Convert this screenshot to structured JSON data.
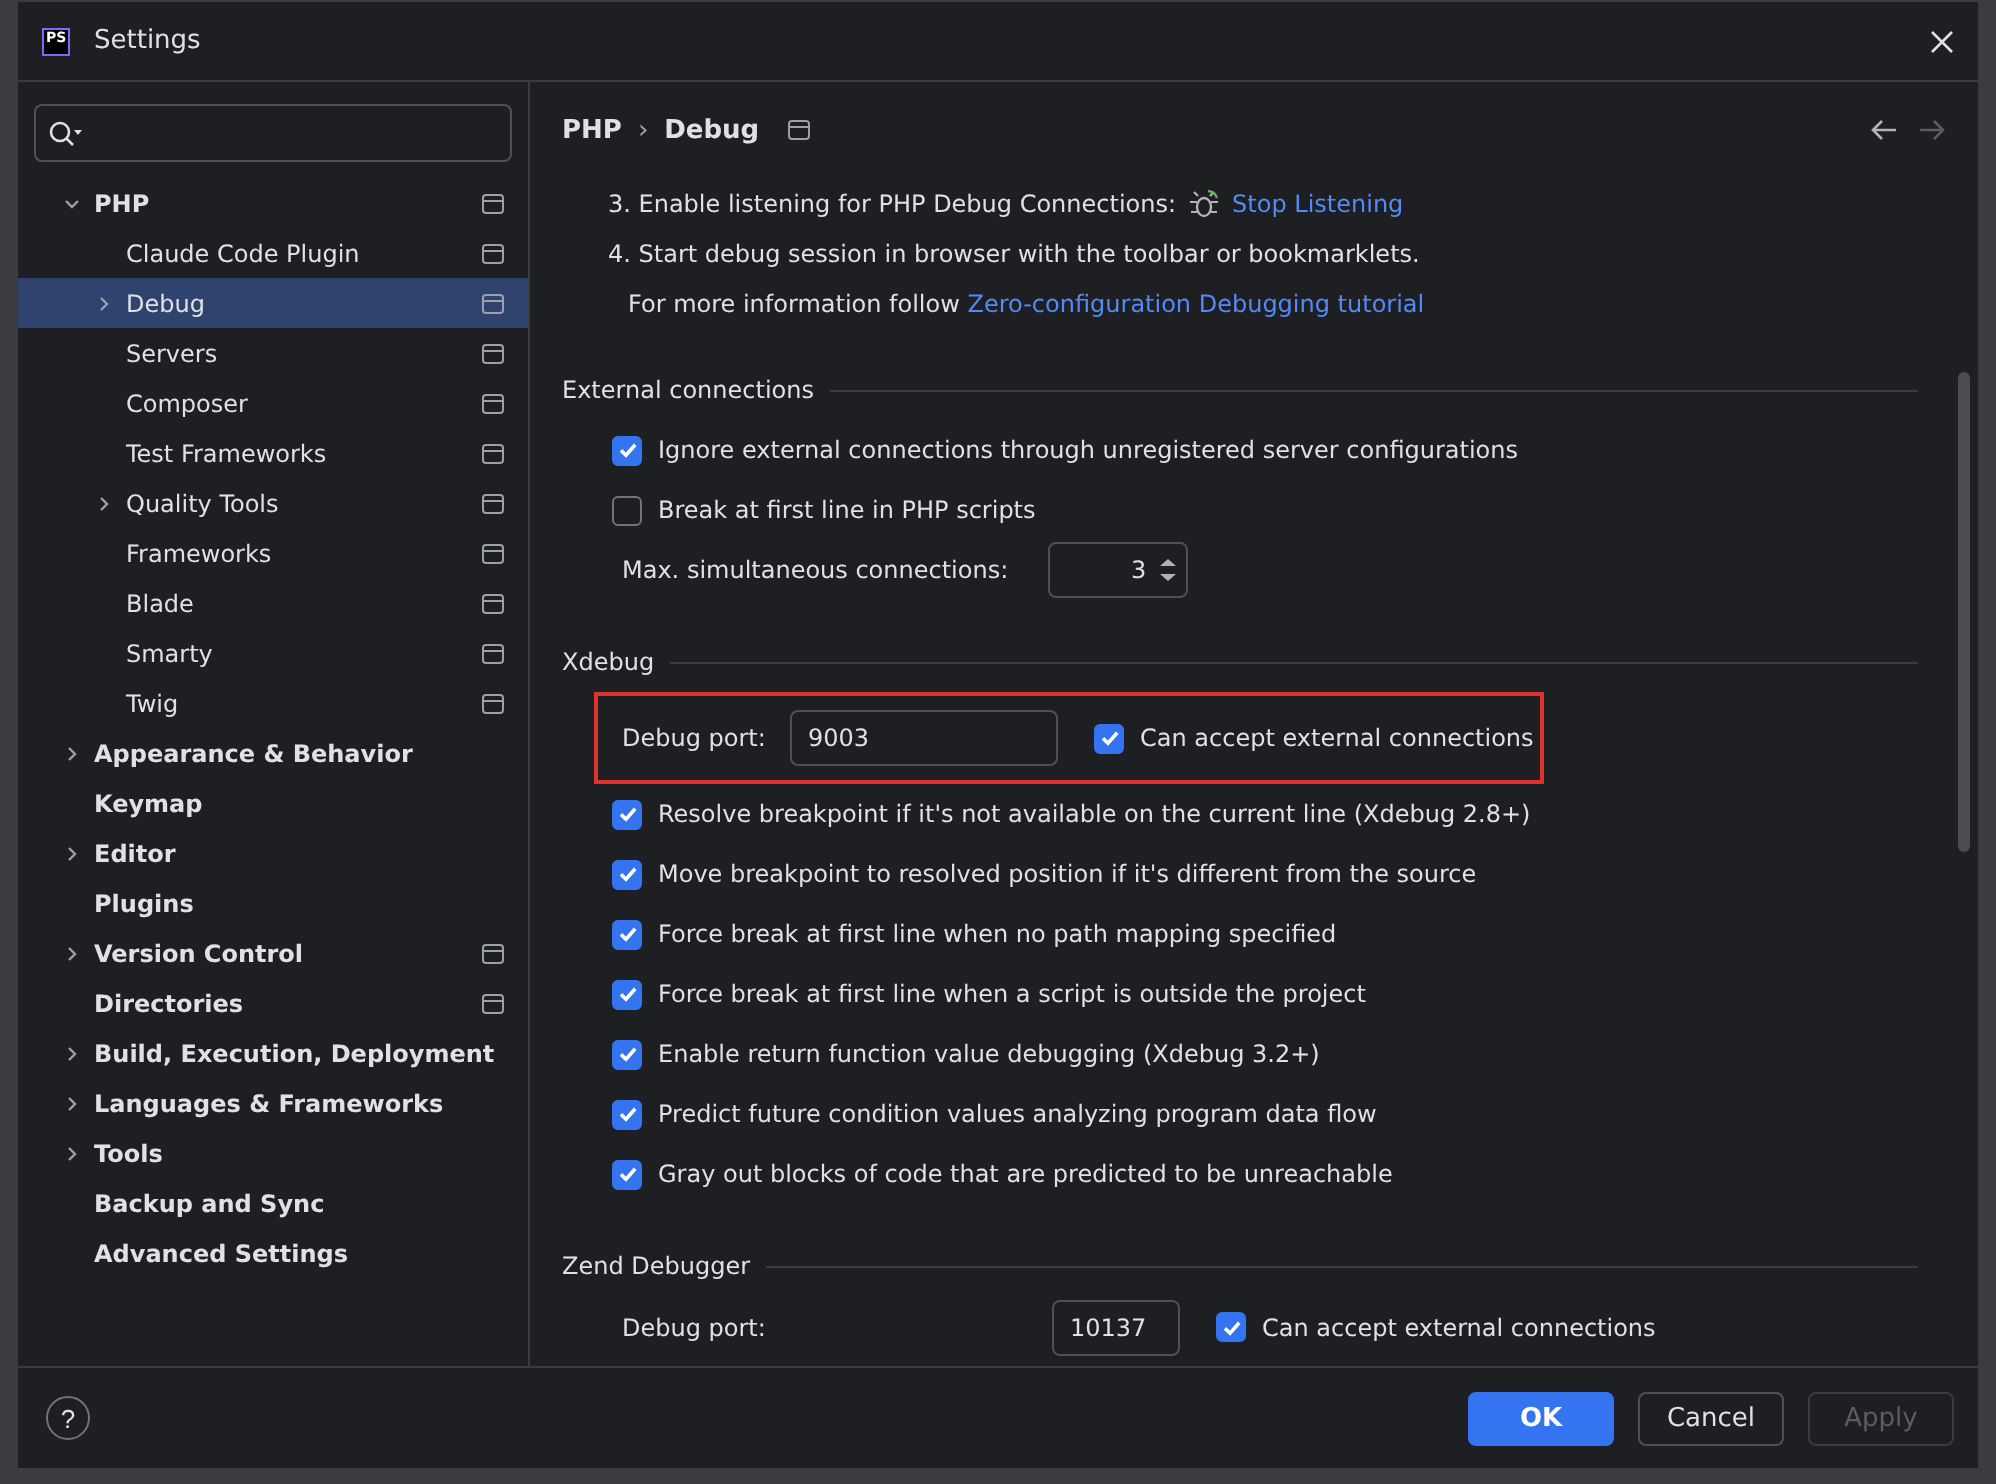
{
  "window": {
    "logo": "PS",
    "title": "Settings"
  },
  "sidebar": {
    "items": [
      {
        "label": "PHP",
        "kind": "group",
        "expanded": true,
        "selected": false,
        "project": true,
        "children": [
          {
            "label": "Claude Code Plugin",
            "kind": "leaf",
            "selected": false,
            "project": true
          },
          {
            "label": "Debug",
            "kind": "group",
            "expanded": false,
            "selected": true,
            "project": true
          },
          {
            "label": "Servers",
            "kind": "leaf",
            "selected": false,
            "project": true
          },
          {
            "label": "Composer",
            "kind": "leaf",
            "selected": false,
            "project": true
          },
          {
            "label": "Test Frameworks",
            "kind": "leaf",
            "selected": false,
            "project": true
          },
          {
            "label": "Quality Tools",
            "kind": "group",
            "expanded": false,
            "selected": false,
            "project": true
          },
          {
            "label": "Frameworks",
            "kind": "leaf",
            "selected": false,
            "project": true
          },
          {
            "label": "Blade",
            "kind": "leaf",
            "selected": false,
            "project": true
          },
          {
            "label": "Smarty",
            "kind": "leaf",
            "selected": false,
            "project": true
          },
          {
            "label": "Twig",
            "kind": "leaf",
            "selected": false,
            "project": true
          }
        ]
      },
      {
        "label": "Appearance & Behavior",
        "kind": "group",
        "expanded": false,
        "selected": false,
        "project": false
      },
      {
        "label": "Keymap",
        "kind": "leaf",
        "selected": false,
        "project": false
      },
      {
        "label": "Editor",
        "kind": "group",
        "expanded": false,
        "selected": false,
        "project": false
      },
      {
        "label": "Plugins",
        "kind": "leaf",
        "selected": false,
        "project": false
      },
      {
        "label": "Version Control",
        "kind": "group",
        "expanded": false,
        "selected": false,
        "project": true
      },
      {
        "label": "Directories",
        "kind": "leaf",
        "selected": false,
        "project": true
      },
      {
        "label": "Build, Execution, Deployment",
        "kind": "group",
        "expanded": false,
        "selected": false,
        "project": false
      },
      {
        "label": "Languages & Frameworks",
        "kind": "group",
        "expanded": false,
        "selected": false,
        "project": false
      },
      {
        "label": "Tools",
        "kind": "group",
        "expanded": false,
        "selected": false,
        "project": false
      },
      {
        "label": "Backup and Sync",
        "kind": "leaf",
        "selected": false,
        "project": false
      },
      {
        "label": "Advanced Settings",
        "kind": "leaf",
        "selected": false,
        "project": false
      }
    ]
  },
  "breadcrumb": {
    "parent": "PHP",
    "separator": "›",
    "current": "Debug",
    "back_disabled": false,
    "forward_disabled": true
  },
  "steps": [
    {
      "text": "3. Enable listening for PHP Debug Connections:",
      "link": "Stop Listening",
      "kind": "action"
    },
    {
      "text": "4. Start debug session in browser with the toolbar or bookmarklets.",
      "kind": "text"
    },
    {
      "text": "For more information follow",
      "link": "Zero-configuration Debugging tutorial",
      "kind": "info"
    }
  ],
  "sections": [
    {
      "title": "External connections",
      "rows": [
        {
          "kind": "checkbox",
          "label": "Ignore external connections through unregistered server configurations",
          "checked": true
        },
        {
          "kind": "checkbox",
          "label": "Break at first line in PHP scripts",
          "checked": false
        },
        {
          "kind": "spinner",
          "label": "Max. simultaneous connections:",
          "value": "3"
        }
      ]
    },
    {
      "title": "Xdebug",
      "rows": [
        {
          "kind": "port",
          "label": "Debug port:",
          "value": "9003",
          "checkbox_label": "Can accept external connections",
          "checked": true,
          "highlighted": true
        },
        {
          "kind": "checkbox",
          "label": "Resolve breakpoint if it's not available on the current line (Xdebug 2.8+)",
          "checked": true
        },
        {
          "kind": "checkbox",
          "label": "Move breakpoint to resolved position if it's different from the source",
          "checked": true
        },
        {
          "kind": "checkbox",
          "label": "Force break at first line when no path mapping specified",
          "checked": true
        },
        {
          "kind": "checkbox",
          "label": "Force break at first line when a script is outside the project",
          "checked": true
        },
        {
          "kind": "checkbox",
          "label": "Enable return function value debugging (Xdebug 3.2+)",
          "checked": true
        },
        {
          "kind": "checkbox",
          "label": "Predict future condition values analyzing program data flow",
          "checked": true
        },
        {
          "kind": "checkbox",
          "label": "Gray out blocks of code that are predicted to be unreachable",
          "checked": true
        }
      ]
    },
    {
      "title": "Zend Debugger",
      "rows": [
        {
          "kind": "port",
          "label": "Debug port:",
          "value": "10137",
          "checkbox_label": "Can accept external connections",
          "checked": true,
          "highlighted": false
        }
      ]
    }
  ],
  "footer": {
    "help": "?",
    "buttons": [
      {
        "label": "OK",
        "kind": "primary",
        "disabled": false
      },
      {
        "label": "Cancel",
        "kind": "normal",
        "disabled": false
      },
      {
        "label": "Apply",
        "kind": "normal",
        "disabled": true
      }
    ]
  }
}
